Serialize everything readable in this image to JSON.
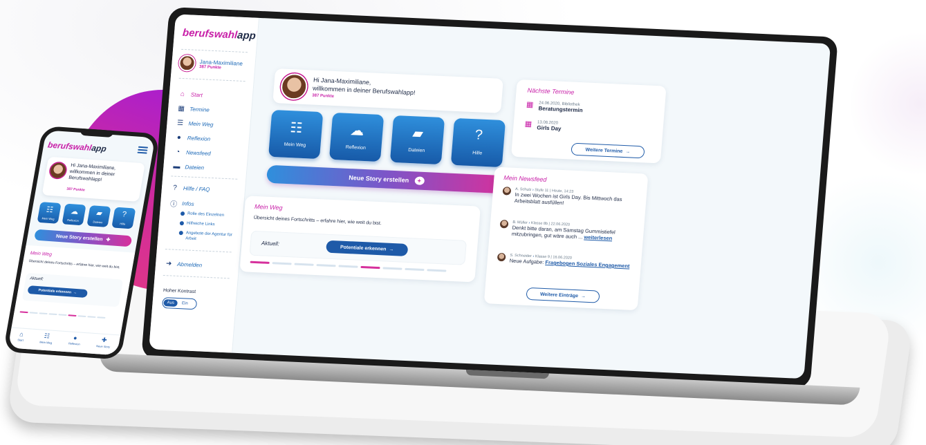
{
  "app": {
    "logo_part1": "berufswahl",
    "logo_part2": "app"
  },
  "user": {
    "name": "Jana-Maximiliane",
    "points": "387 Punkte",
    "greeting": "Hi Jana-Maximiliane,",
    "welcome": "willkommen in deiner Berufswahlapp!",
    "phone_greeting": "Hi Jana-Maximiliane, willkommen in deiner Berufswahlapp!"
  },
  "sidebar": {
    "items": [
      {
        "label": "Start",
        "icon": "home-icon"
      },
      {
        "label": "Termine",
        "icon": "calendar-icon"
      },
      {
        "label": "Mein Weg",
        "icon": "path-icon"
      },
      {
        "label": "Reflexion",
        "icon": "speech-bubble-icon"
      },
      {
        "label": "Newsfeed",
        "icon": "rss-icon"
      },
      {
        "label": "Dateien",
        "icon": "folder-icon"
      },
      {
        "label": "Hilfe / FAQ",
        "icon": "question-icon"
      },
      {
        "label": "Infos",
        "icon": "info-icon"
      }
    ],
    "infos_sub": [
      "Rolle des Einzelnen",
      "Hilfreiche Links",
      "Angebote der Agentur für Arbeit"
    ],
    "logout": "Abmelden",
    "contrast_label": "Hoher Kontrast",
    "contrast_on": "Aus",
    "contrast_off": "Ein"
  },
  "tiles": [
    {
      "label": "Mein Weg",
      "icon": "path-icon"
    },
    {
      "label": "Reflexion",
      "icon": "speech-bubble-icon"
    },
    {
      "label": "Dateien",
      "icon": "folder-icon"
    },
    {
      "label": "Hilfe",
      "icon": "question-icon"
    }
  ],
  "story_button": "Neue Story erstellen",
  "mein_weg": {
    "title": "Mein Weg",
    "description": "Übersicht deines Fortschritts – erfahre hier, wie weit du bist.",
    "current_label": "Aktuell:",
    "current_button": "Potentiale erkennen",
    "progress_total": 9,
    "progress_active": [
      0,
      5
    ]
  },
  "termine": {
    "title": "Nächste Termine",
    "items": [
      {
        "date": "24.06.2020, Bibliothek",
        "title": "Beratungstermin"
      },
      {
        "date": "13.08.2020",
        "title": "Girls Day"
      }
    ],
    "more_button": "Weitere Termine"
  },
  "newsfeed": {
    "title": "Mein Newsfeed",
    "items": [
      {
        "author": "A. Schulz",
        "meta": "Stufe 11 | Heute, 14:23",
        "message": "In zwei Wochen ist Girls Day. Bis Mittwoch das Arbeitsblatt ausfüllen!",
        "link": ""
      },
      {
        "author": "B. Müller",
        "meta": "Klasse 8b | 22.06.2020",
        "message": "Denkt bitte daran, am Samstag Gummistiefel mitzubringen, gut wäre auch ...",
        "link": "weiterlesen"
      },
      {
        "author": "S. Schneider",
        "meta": "Klasse 9 | 16.06.2020",
        "message": "Neue Aufgabe:",
        "link": "Fragebogen Soziales Engagement"
      }
    ],
    "more_button": "Weitere Einträge"
  },
  "phone": {
    "mein_weg_description": "Übersicht deines Fortschritts – erfahre hier, wie weit du bist.",
    "bottom_nav": [
      {
        "label": "Start",
        "icon": "home-icon"
      },
      {
        "label": "Mein Weg",
        "icon": "path-icon"
      },
      {
        "label": "Reflexion",
        "icon": "speech-bubble-icon"
      },
      {
        "label": "Neue Story",
        "icon": "add-story-icon"
      }
    ]
  },
  "colors": {
    "brand_pink": "#c820a8",
    "brand_blue": "#1e5aa8",
    "navy": "#1e2a46"
  }
}
